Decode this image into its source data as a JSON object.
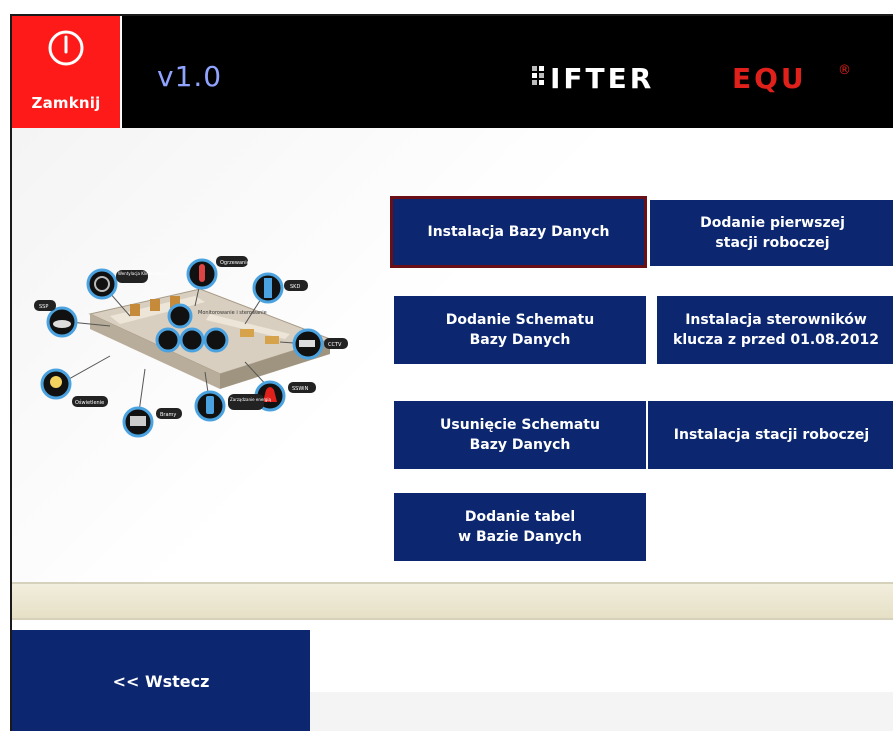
{
  "header": {
    "close_label": "Zamknij",
    "version": "v1.0",
    "logo": {
      "text_white": "IFTER",
      "text_red": "EQU",
      "registered": "®"
    }
  },
  "tiles": [
    {
      "id": "install-db",
      "label": "Instalacja Bazy Danych",
      "selected": true
    },
    {
      "id": "add-first-station",
      "label": "Dodanie pierwszej\nstacji roboczej",
      "selected": false
    },
    {
      "id": "add-schema",
      "label": "Dodanie Schematu\nBazy Danych",
      "selected": false
    },
    {
      "id": "install-drivers",
      "label": "Instalacja sterowników\nklucza z przed 01.08.2012",
      "selected": false
    },
    {
      "id": "remove-schema",
      "label": "Usunięcie Schematu\nBazy Danych",
      "selected": false
    },
    {
      "id": "install-station",
      "label": "Instalacja stacji roboczej",
      "selected": false
    },
    {
      "id": "add-tables",
      "label": "Dodanie tabel\nw Bazie Danych",
      "selected": false
    }
  ],
  "illustration": {
    "labels": {
      "ssp": "SSP",
      "ventilation": "Wentylacja Klimatyzacja",
      "heating": "Ogrzewanie",
      "skd": "SKD",
      "cctv": "CCTV",
      "sswin": "SSWiN",
      "lighting": "Oświetlenie",
      "gates": "Bramy",
      "energy": "Zarządzanie energią",
      "monitoring": "Monitorowanie i sterowanie"
    }
  },
  "footer": {
    "back_label": "<< Wstecz"
  },
  "colors": {
    "tile_bg": "#0c2770",
    "selected_border": "#6b0f17",
    "close_bg": "#ff1a1a",
    "header_bg": "#000000",
    "version_color": "#8fa3ff",
    "logo_red": "#e0211b"
  }
}
